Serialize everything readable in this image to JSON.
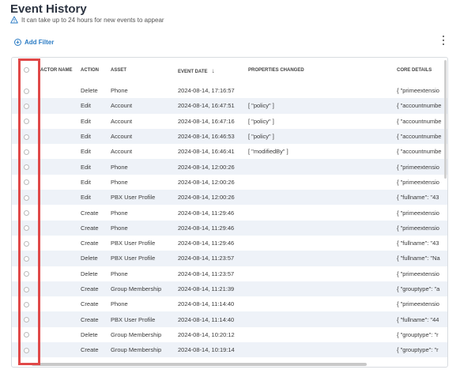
{
  "page": {
    "title": "Event History",
    "subtitle": "It can take up to 24 hours for new events to appear"
  },
  "toolbar": {
    "add_filter_label": "Add Filter"
  },
  "table": {
    "columns": {
      "actor_name": "ACTOR NAME",
      "action": "ACTION",
      "asset": "ASSET",
      "event_date": "EVENT DATE",
      "properties_changed": "PROPERTIES CHANGED",
      "core_details": "CORE DETAILS"
    },
    "sort": {
      "column": "event_date",
      "direction": "descending"
    },
    "rows": [
      {
        "actor": "",
        "action": "Delete",
        "asset": "Phone",
        "date": "2024-08-14, 17:16:57",
        "props": "",
        "core": "{ \"primeextensio"
      },
      {
        "actor": "",
        "action": "Edit",
        "asset": "Account",
        "date": "2024-08-14, 16:47:51",
        "props": "[ \"policy\" ]",
        "core": "{ \"accountnumbe"
      },
      {
        "actor": "",
        "action": "Edit",
        "asset": "Account",
        "date": "2024-08-14, 16:47:16",
        "props": "[ \"policy\" ]",
        "core": "{ \"accountnumbe"
      },
      {
        "actor": "",
        "action": "Edit",
        "asset": "Account",
        "date": "2024-08-14, 16:46:53",
        "props": "[ \"policy\" ]",
        "core": "{ \"accountnumbe"
      },
      {
        "actor": "",
        "action": "Edit",
        "asset": "Account",
        "date": "2024-08-14, 16:46:41",
        "props": "[ \"modifiedBy\" ]",
        "core": "{ \"accountnumbe"
      },
      {
        "actor": "",
        "action": "Edit",
        "asset": "Phone",
        "date": "2024-08-14, 12:00:26",
        "props": "",
        "core": "{ \"primeextensio"
      },
      {
        "actor": "",
        "action": "Edit",
        "asset": "Phone",
        "date": "2024-08-14, 12:00:26",
        "props": "",
        "core": "{ \"primeextensio"
      },
      {
        "actor": "",
        "action": "Edit",
        "asset": "PBX User Profile",
        "date": "2024-08-14, 12:00:26",
        "props": "",
        "core": "{ \"fullname\": \"43"
      },
      {
        "actor": "",
        "action": "Create",
        "asset": "Phone",
        "date": "2024-08-14, 11:29:46",
        "props": "",
        "core": "{ \"primeextensio"
      },
      {
        "actor": "",
        "action": "Create",
        "asset": "Phone",
        "date": "2024-08-14, 11:29:46",
        "props": "",
        "core": "{ \"primeextensio"
      },
      {
        "actor": "",
        "action": "Create",
        "asset": "PBX User Profile",
        "date": "2024-08-14, 11:29:46",
        "props": "",
        "core": "{ \"fullname\": \"43"
      },
      {
        "actor": "",
        "action": "Delete",
        "asset": "PBX User Profile",
        "date": "2024-08-14, 11:23:57",
        "props": "",
        "core": "{ \"fullname\": \"Na"
      },
      {
        "actor": "",
        "action": "Delete",
        "asset": "Phone",
        "date": "2024-08-14, 11:23:57",
        "props": "",
        "core": "{ \"primeextensio"
      },
      {
        "actor": "",
        "action": "Create",
        "asset": "Group Membership",
        "date": "2024-08-14, 11:21:39",
        "props": "",
        "core": "{ \"grouptype\": \"a"
      },
      {
        "actor": "",
        "action": "Create",
        "asset": "Phone",
        "date": "2024-08-14, 11:14:40",
        "props": "",
        "core": "{ \"primeextensio"
      },
      {
        "actor": "",
        "action": "Create",
        "asset": "PBX User Profile",
        "date": "2024-08-14, 11:14:40",
        "props": "",
        "core": "{ \"fullname\": \"44"
      },
      {
        "actor": "",
        "action": "Delete",
        "asset": "Group Membership",
        "date": "2024-08-14, 10:20:12",
        "props": "",
        "core": "{ \"grouptype\": \"r"
      },
      {
        "actor": "",
        "action": "Create",
        "asset": "Group Membership",
        "date": "2024-08-14, 10:19:14",
        "props": "",
        "core": "{ \"grouptype\": \"r"
      }
    ]
  },
  "colors": {
    "title": "#2b3340",
    "link": "#2a7bc4",
    "warning": "#2a7bc4",
    "stripe": "#eef2f8",
    "highlight": "#e04848"
  },
  "icons": {
    "warning": "warning-triangle-icon",
    "add": "plus-circle-icon",
    "more": "kebab-menu-icon",
    "sort": "arrow-down-icon"
  }
}
